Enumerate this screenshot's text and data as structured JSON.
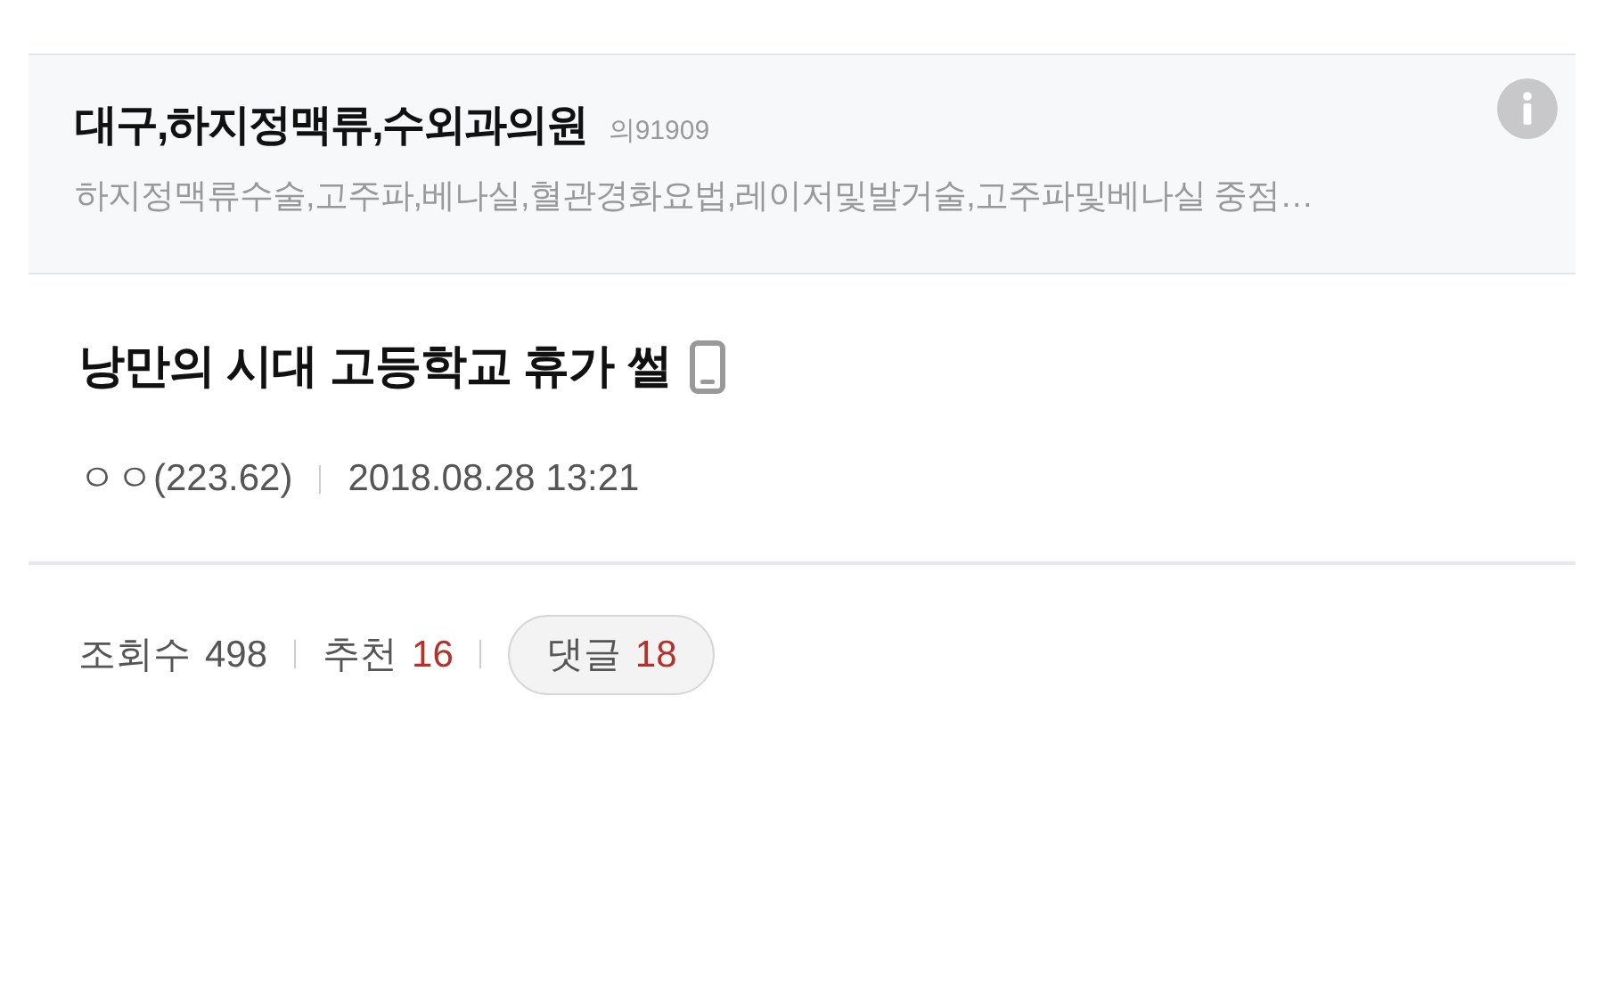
{
  "ad": {
    "title": "대구,하지정맥류,수외과의원",
    "code": "의91909",
    "description": "하지정맥류수술,고주파,베나실,혈관경화요법,레이저및발거술,고주파및베나실 중점…"
  },
  "post": {
    "title": "낭만의 시대 고등학교 휴가 썰",
    "mobile": true,
    "author": "ㅇㅇ(223.62)",
    "date": "2018.08.28 13:21"
  },
  "stats": [
    {
      "label": "조회수",
      "value": "498",
      "kind": "plain"
    },
    {
      "label": "추천",
      "value": "16",
      "kind": "plain"
    },
    {
      "label": "댓글",
      "value": "18",
      "kind": "pill"
    }
  ]
}
